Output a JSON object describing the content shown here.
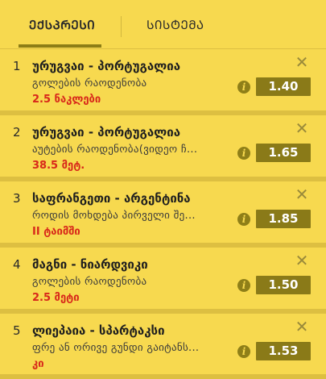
{
  "tabs": {
    "express": "ᲔᲥᲡᲞᲠᲔᲡᲘ",
    "system": "ᲡᲘᲡᲢᲔᲛᲐ"
  },
  "icons": {
    "close": "close-icon",
    "info": "info-icon"
  },
  "colors": {
    "panel": "#f7d94f",
    "odd_bg": "#8a7a18",
    "pick": "#d8281a"
  },
  "bets": [
    {
      "num": "1",
      "teams": "ურუგვაი - პორტუგალია",
      "market": "გოლების რაოდენობა",
      "pick": "2.5 ნაკლები",
      "odd": "1.40"
    },
    {
      "num": "2",
      "teams": "ურუგვაი - პორტუგალია",
      "market": "აუტების რაოდენობა(ვიდეო ჩ...",
      "pick": "38.5 მეტ.",
      "odd": "1.65"
    },
    {
      "num": "3",
      "teams": "საფრანგეთი - არგენტინა",
      "market": "როდის მოხდება პირველი შე...",
      "pick": "II ტაიმში",
      "odd": "1.85"
    },
    {
      "num": "4",
      "teams": "მაგნი - ნიარდვიკი",
      "market": "გოლების რაოდენობა",
      "pick": "2.5 მეტი",
      "odd": "1.50"
    },
    {
      "num": "5",
      "teams": "ლიეპაია - სპარტაკსი",
      "market": "ფრე ან ორივე გუნდი გაიტანს...",
      "pick": "კი",
      "odd": "1.53"
    }
  ]
}
